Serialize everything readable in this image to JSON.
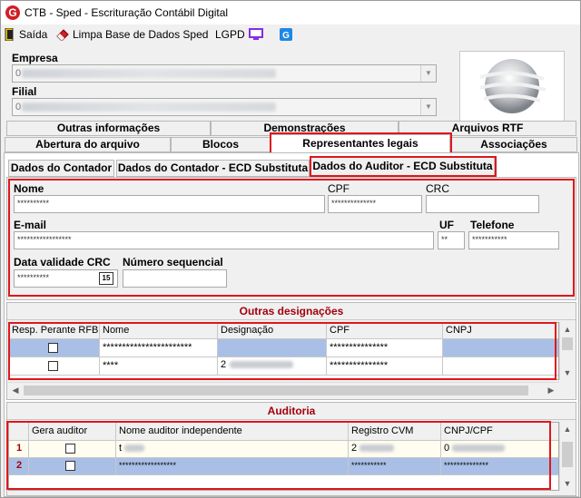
{
  "window": {
    "title": "CTB - Sped - Escrituração Contábil Digital"
  },
  "toolbar": {
    "saida": "Saída",
    "limpa": "Limpa Base de Dados Sped",
    "lgpd": "LGPD"
  },
  "empresa": {
    "label": "Empresa",
    "value": "0"
  },
  "filial": {
    "label": "Filial",
    "value": "0"
  },
  "tabs_row1": [
    "Outras informações",
    "Demonstrações",
    "Arquivos RTF"
  ],
  "tabs_row2": [
    "Abertura do arquivo",
    "Blocos",
    "Representantes legais",
    "Associações"
  ],
  "subtabs": [
    "Dados do Contador",
    "Dados do Contador - ECD Substituta",
    "Dados do Auditor - ECD Substituta"
  ],
  "form": {
    "nome_label": "Nome",
    "nome_value": "**********",
    "cpf_label": "CPF",
    "cpf_value": "**************",
    "crc_label": "CRC",
    "crc_value": "",
    "email_label": "E-mail",
    "email_value": "*****************",
    "uf_label": "UF",
    "uf_value": "**",
    "telefone_label": "Telefone",
    "telefone_value": "***********",
    "data_label": "Data validade CRC",
    "data_value": "**********",
    "calendar_day": "15",
    "numero_label": "Número sequencial",
    "numero_value": ""
  },
  "outras": {
    "title": "Outras designações",
    "columns": [
      "Resp. Perante RFB",
      "Nome",
      "Designação",
      "CPF",
      "CNPJ"
    ],
    "rows": [
      {
        "nome": "***********************",
        "designacao": "",
        "cpf": "***************",
        "cnpj": ""
      },
      {
        "nome": "****",
        "designacao": "2",
        "cpf": "***************",
        "cnpj": ""
      }
    ]
  },
  "auditoria": {
    "title": "Auditoria",
    "columns": [
      "Gera auditor",
      "Nome auditor independente",
      "Registro CVM",
      "CNPJ/CPF"
    ],
    "rows": [
      {
        "num": "1",
        "nome": "t",
        "cvm": "2",
        "cnpj": "0"
      },
      {
        "num": "2",
        "nome": "******************",
        "cvm": "***********",
        "cnpj": "**************"
      }
    ]
  },
  "colors": {
    "accent_red": "#e0161c",
    "section_title": "#a3000b",
    "selected_row": "#a9bfe6"
  }
}
